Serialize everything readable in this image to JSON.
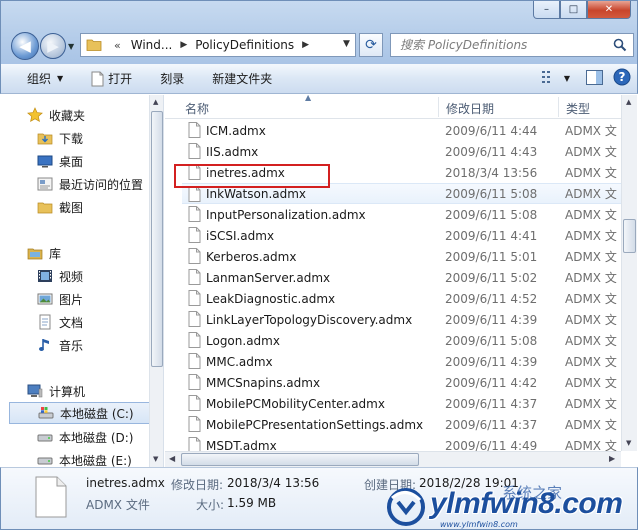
{
  "window": {
    "controls": {
      "minimize": "–",
      "maximize": "□",
      "close": "✕"
    }
  },
  "nav": {
    "back_icon": "back-arrow-icon",
    "forward_icon": "forward-arrow-icon"
  },
  "address": {
    "crumbs": [
      "Wind...",
      "PolicyDefinitions"
    ],
    "leading": "«"
  },
  "search": {
    "placeholder": "搜索 PolicyDefinitions"
  },
  "toolbar": {
    "organize": "组织",
    "open": "打开",
    "burn": "刻录",
    "new_folder": "新建文件夹"
  },
  "sidebar": {
    "favorites": {
      "label": "收藏夹",
      "items": [
        "下载",
        "桌面",
        "最近访问的位置",
        "截图"
      ]
    },
    "libraries": {
      "label": "库",
      "items": [
        "视频",
        "图片",
        "文档",
        "音乐"
      ]
    },
    "computer": {
      "label": "计算机",
      "items": [
        "本地磁盘 (C:)",
        "本地磁盘 (D:)",
        "本地磁盘 (E:)"
      ]
    }
  },
  "columns": {
    "name": "名称",
    "date": "修改日期",
    "type": "类型"
  },
  "files": [
    {
      "name": "ICM.admx",
      "date": "2009/6/11 4:44",
      "type": "ADMX 文"
    },
    {
      "name": "IIS.admx",
      "date": "2009/6/11 4:43",
      "type": "ADMX 文"
    },
    {
      "name": "inetres.admx",
      "date": "2018/3/4 13:56",
      "type": "ADMX 文"
    },
    {
      "name": "InkWatson.admx",
      "date": "2009/6/11 5:08",
      "type": "ADMX 文"
    },
    {
      "name": "InputPersonalization.admx",
      "date": "2009/6/11 5:08",
      "type": "ADMX 文"
    },
    {
      "name": "iSCSI.admx",
      "date": "2009/6/11 4:41",
      "type": "ADMX 文"
    },
    {
      "name": "Kerberos.admx",
      "date": "2009/6/11 5:01",
      "type": "ADMX 文"
    },
    {
      "name": "LanmanServer.admx",
      "date": "2009/6/11 5:02",
      "type": "ADMX 文"
    },
    {
      "name": "LeakDiagnostic.admx",
      "date": "2009/6/11 4:52",
      "type": "ADMX 文"
    },
    {
      "name": "LinkLayerTopologyDiscovery.admx",
      "date": "2009/6/11 4:39",
      "type": "ADMX 文"
    },
    {
      "name": "Logon.admx",
      "date": "2009/6/11 5:08",
      "type": "ADMX 文"
    },
    {
      "name": "MMC.admx",
      "date": "2009/6/11 4:39",
      "type": "ADMX 文"
    },
    {
      "name": "MMCSnapins.admx",
      "date": "2009/6/11 4:42",
      "type": "ADMX 文"
    },
    {
      "name": "MobilePCMobilityCenter.admx",
      "date": "2009/6/11 4:37",
      "type": "ADMX 文"
    },
    {
      "name": "MobilePCPresentationSettings.admx",
      "date": "2009/6/11 4:37",
      "type": "ADMX 文"
    },
    {
      "name": "MSDT.admx",
      "date": "2009/6/11 4:49",
      "type": "ADMX 文"
    }
  ],
  "details": {
    "filename": "inetres.admx",
    "filetype": "ADMX 文件",
    "modified_label": "修改日期:",
    "modified_value": "2018/3/4 13:56",
    "created_label": "创建日期:",
    "created_value": "2018/2/28 19:01",
    "size_label": "大小:",
    "size_value": "1.59 MB"
  },
  "watermark": {
    "text": "ylmfwin8.com",
    "overlay": "系统之家",
    "site": "www.ylmfwin8.com"
  },
  "colors": {
    "highlight_box": "#d32020",
    "window_frame": "#6f8fb8",
    "watermark": "#1c4f9e"
  }
}
